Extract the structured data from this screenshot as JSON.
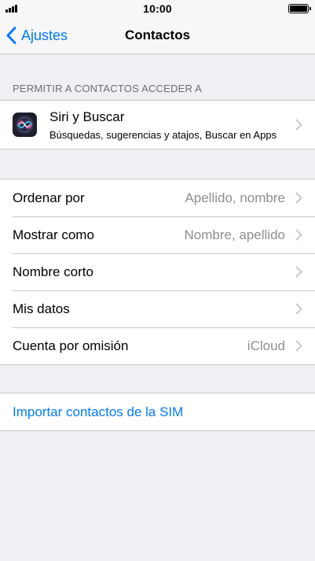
{
  "status_bar": {
    "time": "10:00"
  },
  "nav": {
    "back_label": "Ajustes",
    "title": "Contactos"
  },
  "allow_section": {
    "header": "PERMITIR A CONTACTOS ACCEDER A",
    "siri": {
      "title": "Siri y Buscar",
      "subtitle": "Búsquedas, sugerencias y atajos, Buscar en Apps"
    }
  },
  "settings": [
    {
      "label": "Ordenar por",
      "value": "Apellido, nombre"
    },
    {
      "label": "Mostrar como",
      "value": "Nombre, apellido"
    },
    {
      "label": "Nombre corto",
      "value": ""
    },
    {
      "label": "Mis datos",
      "value": ""
    },
    {
      "label": "Cuenta por omisión",
      "value": "iCloud"
    }
  ],
  "import": {
    "label": "Importar contactos de la SIM"
  },
  "colors": {
    "accent": "#007aff",
    "background": "#efeff4",
    "secondary_text": "#8e8e93",
    "separator": "#c8c7cc"
  },
  "icons": [
    "signal-icon",
    "battery-icon",
    "back-chevron-icon",
    "siri-icon",
    "chevron-right-icon"
  ]
}
